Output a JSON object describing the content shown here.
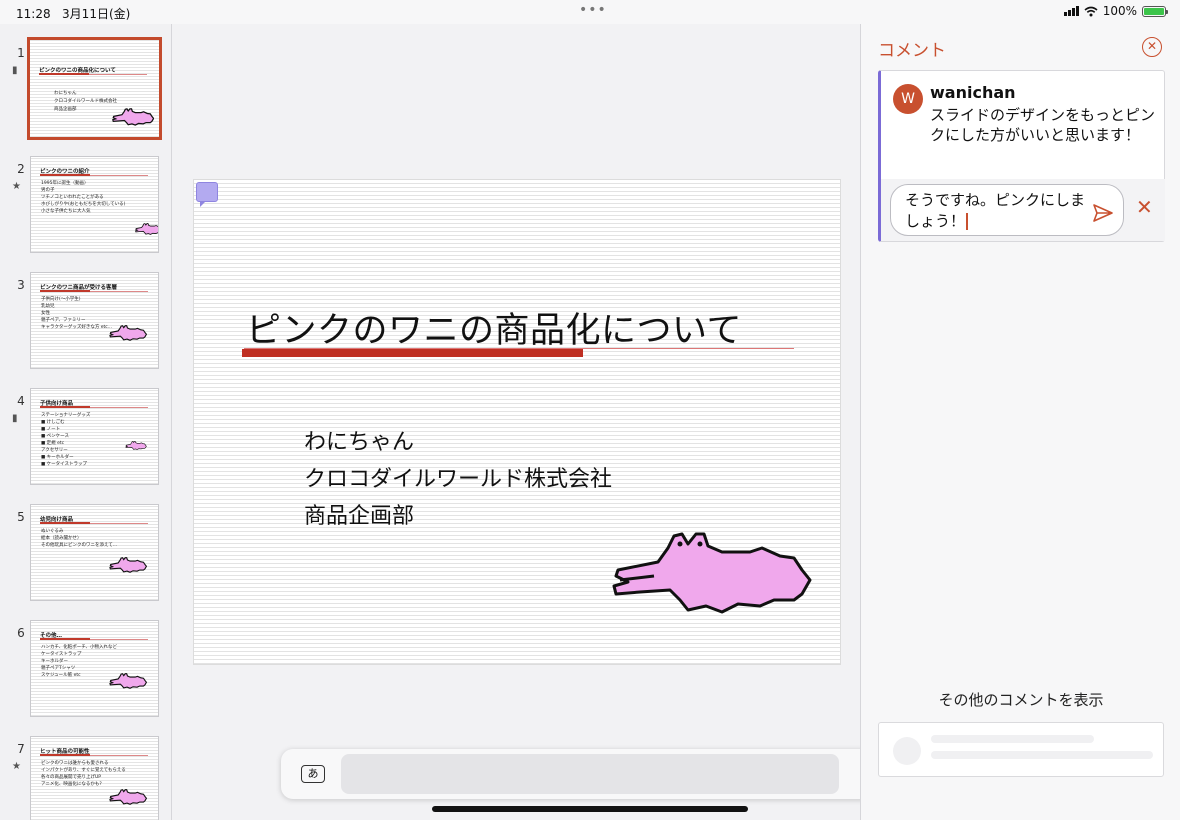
{
  "status_bar": {
    "time": "11:28",
    "date": "3月11日(金)",
    "more_dots": "•••",
    "battery": "100%"
  },
  "thumbnails": [
    {
      "num": "1",
      "mark": "comment",
      "title": "ピンクのワニの商品化について",
      "lines": [],
      "sub": [
        "わにちゃん",
        "クロコダイルワールド株式会社",
        "商品企画部"
      ]
    },
    {
      "num": "2",
      "mark": "star",
      "title": "ピンクのワニの紹介",
      "lines": [
        "1995年に誕生（動画）",
        "男の子",
        "ツチノコといわれたことがある",
        "ホびしがりや(おともだちを大切している)",
        "小さな子供たちに大人気"
      ],
      "sub": []
    },
    {
      "num": "3",
      "mark": "",
      "title": "ピンクのワニ商品が受ける客層",
      "lines": [
        "子供向け(〜小学生)",
        "乳幼児",
        "女性",
        "親子ペア、ファミリー",
        "キャラクターグッズ好きな方 etc..."
      ],
      "sub": []
    },
    {
      "num": "4",
      "mark": "comment",
      "title": "子供向け商品",
      "lines": [
        "ステーショナリーグッズ",
        "■ けしごむ",
        "■ ノート",
        "■ ペンケース",
        "■ 定規 etc",
        "アクセサリー",
        "■ キーホルダー",
        "■ ケータイストラップ"
      ],
      "sub": []
    },
    {
      "num": "5",
      "mark": "",
      "title": "幼児向け商品",
      "lines": [
        "ぬいぐるみ",
        "絵本（読み聞かせ）",
        "その他玩具にピンクのワニを添えて..."
      ],
      "sub": []
    },
    {
      "num": "6",
      "mark": "",
      "title": "その他…",
      "lines": [
        "ハンカチ、化粧ポーチ、小物入れなど",
        "ケータイストラップ",
        "キーホルダー",
        "親子ペアTシャツ",
        "スケジュール帳 etc"
      ],
      "sub": []
    },
    {
      "num": "7",
      "mark": "star",
      "title": "ヒット商品の可能性",
      "lines": [
        "ピンクのワニは誰からも愛される",
        "インパクトがあり、すぐに覚えてもらえる",
        "各々の商品展開で売り上げUP",
        "アニメ化、映画化になるかも?"
      ],
      "sub": []
    }
  ],
  "slide": {
    "title": "ピンクのワニの商品化について",
    "subtitle_lines": [
      "わにちゃん",
      "クロコダイルワールド株式会社",
      "商品企画部"
    ]
  },
  "comments_panel": {
    "title": "コメント",
    "author_initial": "W",
    "author": "wanichan",
    "comment_text": "スライドのデザインをもっとピンクにした方がいいと思います！",
    "reply_text": "そうですね。ピンクにしましょう！",
    "more_comments": "その他のコメントを表示"
  },
  "toolbar": {
    "keyboard_label": "あ"
  },
  "colors": {
    "accent": "#c8502f",
    "comment_border": "#7b6bd6",
    "title_bar": "#bf2f22",
    "croc_pink": "#f0a8ec"
  }
}
